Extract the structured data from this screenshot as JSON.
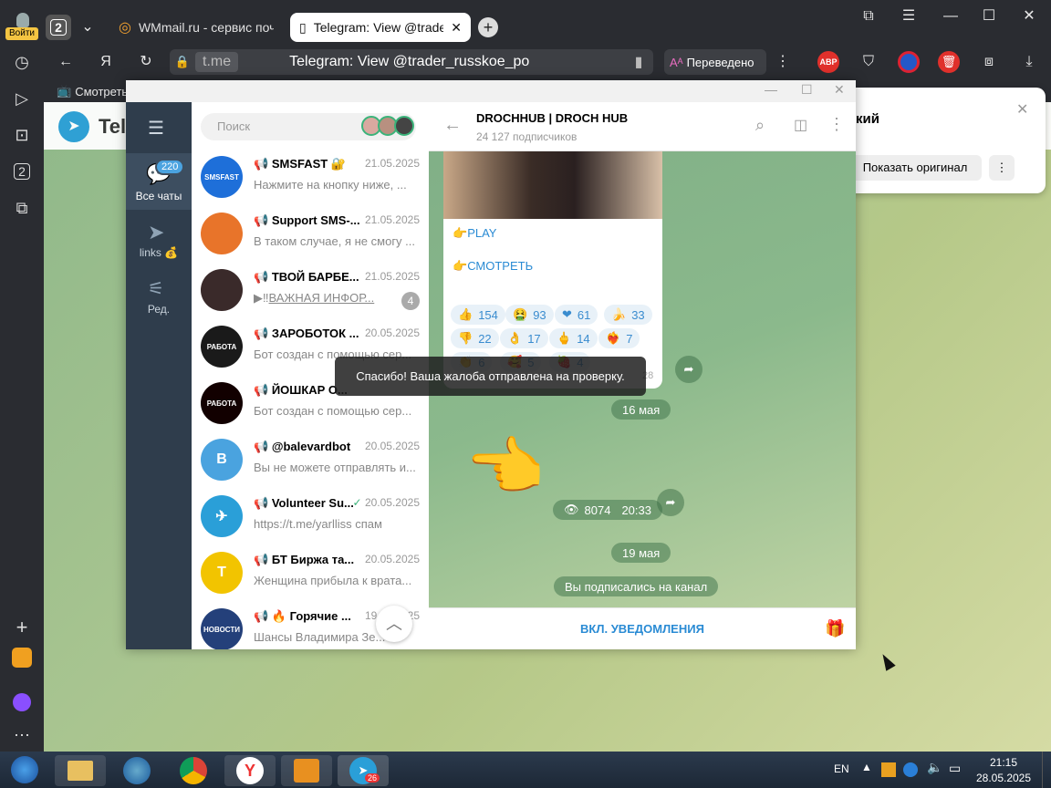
{
  "browser": {
    "login_label": "Войти",
    "tab_count": "2",
    "tabs": [
      {
        "title": "WMmail.ru - сервис почто"
      },
      {
        "title": "Telegram: View @trade"
      }
    ],
    "address": {
      "domain": "t.me",
      "title": "Telegram: View @trader_russkoe_po"
    },
    "translated_label": "Переведено",
    "abp_label": "ABP",
    "bookmark_label": "Смотреть",
    "page_title_partial": "Tele",
    "translate_popup": {
      "title_partial": "кий",
      "show_original": "Показать оригинал"
    }
  },
  "telegram": {
    "sidebar": {
      "all_chats_label": "Все чаты",
      "all_chats_badge": "220",
      "links_label": "links 💰",
      "edit_label": "Ред."
    },
    "search_placeholder": "Поиск",
    "chats": [
      {
        "name": "SMSFAST 🔐",
        "date": "21.05.2025",
        "preview": "Нажмите на кнопку ниже, ...",
        "avatar_text": "SMSFAST",
        "avatar_color": "#1e6fd9"
      },
      {
        "name": "Support SMS-...",
        "date": "21.05.2025",
        "preview": "В таком случае, я не смогу ...",
        "avatar_text": "",
        "avatar_color": "#e8742a"
      },
      {
        "name": "ТВОЙ БАРБЕ...",
        "date": "21.05.2025",
        "preview": "ВАЖНАЯ ИНФОР...",
        "preview_prefix": "▶‼",
        "badge": "4",
        "avatar_text": "",
        "avatar_color": "#3a2a2a"
      },
      {
        "name": "ЗАРОБОТОК ...",
        "date": "20.05.2025",
        "preview": "Бот создан с помощью сер...",
        "avatar_text": "РАБОТА",
        "avatar_color": "#1a1a1a"
      },
      {
        "name": "ЙОШКАР О...",
        "date": "",
        "preview": "Бот создан с помощью сер...",
        "avatar_text": "РАБОТА",
        "avatar_color": "#120000"
      },
      {
        "name": "@balevardbot",
        "date": "20.05.2025",
        "preview": "Вы не можете отправлять и...",
        "avatar_text": "B",
        "avatar_color": "#4aa3df"
      },
      {
        "name": "Volunteer Su...",
        "date": "20.05.2025",
        "preview": "https://t.me/yarlliss спам",
        "avatar_text": "✈",
        "avatar_color": "#2a9fd8",
        "read": true
      },
      {
        "name": "БТ Биржа та...",
        "date": "20.05.2025",
        "preview": "Женщина прибыла к врата...",
        "avatar_text": "T",
        "avatar_color": "#f2c400"
      },
      {
        "name": "🔥 Горячие ...",
        "date": "19.05.2025",
        "preview": "Шансы Владимира Зе...",
        "avatar_text": "НОВОСТИ",
        "avatar_color": "#24407a"
      }
    ],
    "channel": {
      "title": "DROCHHUB | DROCH HUB",
      "subscribers": "24 127 подписчиков",
      "links": [
        "PLAY",
        "СМОТРЕТЬ"
      ],
      "reactions": [
        {
          "emoji": "👍",
          "count": "154"
        },
        {
          "emoji": "🤮",
          "count": "93"
        },
        {
          "emoji": "❤",
          "count": "61"
        },
        {
          "emoji": "🍌",
          "count": "33"
        },
        {
          "emoji": "👎",
          "count": "22"
        },
        {
          "emoji": "👌",
          "count": "17"
        },
        {
          "emoji": "🖕",
          "count": "14"
        },
        {
          "emoji": "❤‍🔥",
          "count": "7"
        },
        {
          "emoji": "👏",
          "count": "6"
        },
        {
          "emoji": "🥰",
          "count": "5"
        },
        {
          "emoji": "🍓",
          "count": "4"
        }
      ],
      "msg_time_partial": "28",
      "toast": "Спасибо! Ваша жалоба отправлена на проверку.",
      "date1": "16 мая",
      "views": "8074",
      "time2": "20:33",
      "date2": "19 мая",
      "subscribed_notice": "Вы подписались на канал",
      "notify_button": "ВКЛ. УВЕДОМЛЕНИЯ"
    }
  },
  "taskbar": {
    "lang": "EN",
    "time": "21:15",
    "date": "28.05.2025",
    "tg_badge": "26"
  }
}
